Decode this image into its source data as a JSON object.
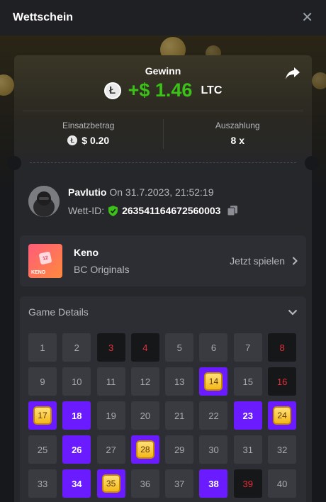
{
  "header": {
    "title": "Wettschein"
  },
  "win": {
    "label": "Gewinn",
    "amount": "+$ 1.46",
    "currency": "LTC",
    "coin_symbol": "Ł"
  },
  "stats": {
    "stake_label": "Einsatzbetrag",
    "stake_value": "$ 0.20",
    "payout_label": "Auszahlung",
    "payout_value": "8 x"
  },
  "user": {
    "name": "Pavlutio",
    "date": "On 31.7.2023, 21:52:19",
    "bet_id_label": "Wett-ID:",
    "bet_id": "263541164672560003"
  },
  "game": {
    "name": "Keno",
    "provider": "BC Originals",
    "play_label": "Jetzt spielen",
    "thumb_label": "KENO",
    "thumb_tile": "12"
  },
  "details": {
    "title": "Game Details"
  },
  "board": {
    "cells": [
      {
        "n": "1",
        "s": "normal"
      },
      {
        "n": "2",
        "s": "normal"
      },
      {
        "n": "3",
        "s": "miss"
      },
      {
        "n": "4",
        "s": "miss"
      },
      {
        "n": "5",
        "s": "normal"
      },
      {
        "n": "6",
        "s": "normal"
      },
      {
        "n": "7",
        "s": "normal"
      },
      {
        "n": "8",
        "s": "miss"
      },
      {
        "n": "9",
        "s": "normal"
      },
      {
        "n": "10",
        "s": "normal"
      },
      {
        "n": "11",
        "s": "normal"
      },
      {
        "n": "12",
        "s": "normal"
      },
      {
        "n": "13",
        "s": "normal"
      },
      {
        "n": "14",
        "s": "hit"
      },
      {
        "n": "15",
        "s": "normal"
      },
      {
        "n": "16",
        "s": "miss"
      },
      {
        "n": "17",
        "s": "hit"
      },
      {
        "n": "18",
        "s": "pick"
      },
      {
        "n": "19",
        "s": "normal"
      },
      {
        "n": "20",
        "s": "normal"
      },
      {
        "n": "21",
        "s": "normal"
      },
      {
        "n": "22",
        "s": "normal"
      },
      {
        "n": "23",
        "s": "pick"
      },
      {
        "n": "24",
        "s": "hit"
      },
      {
        "n": "25",
        "s": "normal"
      },
      {
        "n": "26",
        "s": "pick"
      },
      {
        "n": "27",
        "s": "normal"
      },
      {
        "n": "28",
        "s": "hit"
      },
      {
        "n": "29",
        "s": "normal"
      },
      {
        "n": "30",
        "s": "normal"
      },
      {
        "n": "31",
        "s": "normal"
      },
      {
        "n": "32",
        "s": "normal"
      },
      {
        "n": "33",
        "s": "normal"
      },
      {
        "n": "34",
        "s": "pick"
      },
      {
        "n": "35",
        "s": "hit"
      },
      {
        "n": "36",
        "s": "normal"
      },
      {
        "n": "37",
        "s": "normal"
      },
      {
        "n": "38",
        "s": "pick"
      },
      {
        "n": "39",
        "s": "miss"
      },
      {
        "n": "40",
        "s": "normal"
      }
    ]
  },
  "colors": {
    "win_green": "#3bc117",
    "pick_purple": "#6b1bff",
    "miss_red": "#e5303a",
    "hit_gold": "#f5b81a"
  },
  "icons": {
    "close": "close-icon",
    "share": "share-icon",
    "shield": "verified-shield-icon",
    "copy": "copy-icon",
    "chevron_right": "chevron-right-icon",
    "chevron_down": "chevron-down-icon"
  }
}
